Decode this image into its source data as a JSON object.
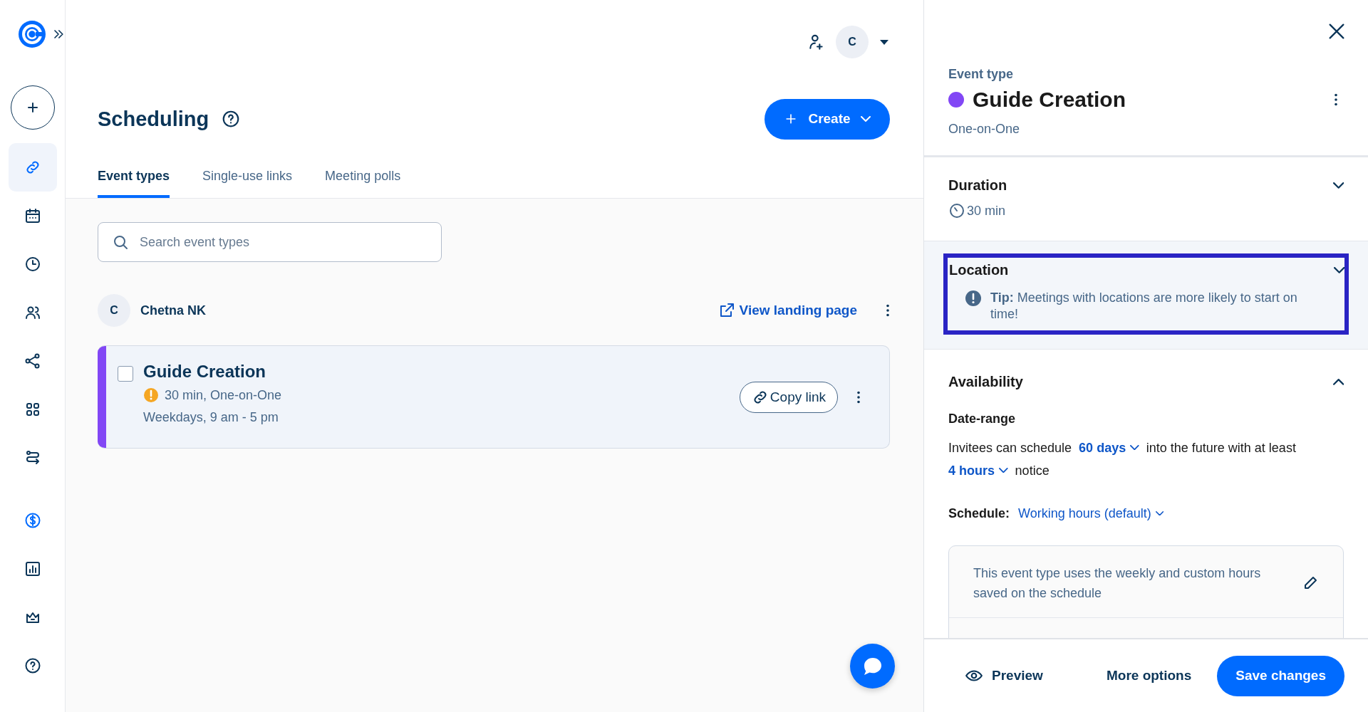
{
  "sidebar": {
    "items": [
      {
        "kind": "create",
        "selected": false
      },
      {
        "kind": "link",
        "selected": true
      },
      {
        "kind": "calendar",
        "selected": false
      },
      {
        "kind": "clock",
        "selected": false
      },
      {
        "kind": "people",
        "selected": false
      },
      {
        "kind": "share",
        "selected": false
      },
      {
        "kind": "grid",
        "selected": false
      },
      {
        "kind": "routing",
        "selected": false
      },
      {
        "kind": "dollar",
        "selected": false
      },
      {
        "kind": "chart",
        "selected": false
      },
      {
        "kind": "crown",
        "selected": false
      },
      {
        "kind": "help",
        "selected": false
      }
    ]
  },
  "header": {
    "avatar": "C"
  },
  "page": {
    "title": "Scheduling",
    "create_button": "Create",
    "tabs": [
      {
        "label": "Event types",
        "selected": true
      },
      {
        "label": "Single-use links",
        "selected": false
      },
      {
        "label": "Meeting polls",
        "selected": false
      }
    ],
    "search": {
      "placeholder": "Search event types"
    },
    "owner": {
      "avatar": "C",
      "name": "Chetna NK",
      "landing_link": "View landing page"
    },
    "event_cards": [
      {
        "title": "Guide Creation",
        "color": "#8247f5",
        "checked": false,
        "warning": true,
        "details": "30 min, One-on-One",
        "schedule": "Weekdays, 9 am - 5 pm",
        "copy_button": "Copy link"
      }
    ]
  },
  "panel": {
    "label": "Event type",
    "title": "Guide Creation",
    "color": "#8247f5",
    "subtitle": "One-on-One",
    "sections": [
      {
        "kind": "duration",
        "title": "Duration",
        "expanded": false,
        "highlighted": false,
        "value": "30 min"
      },
      {
        "kind": "location",
        "title": "Location",
        "expanded": false,
        "highlighted": true,
        "tip": "**Tip:** Meetings with locations are more likely to start on time!"
      },
      {
        "kind": "availability",
        "title": "Availability",
        "expanded": true,
        "highlighted": false,
        "subheading": "Date-range",
        "sentence": [
          {
            "kind": "text",
            "text": "Invitees can schedule"
          },
          {
            "kind": "dropdown",
            "text": "60 days"
          },
          {
            "kind": "text",
            "text": "into the future with at least"
          },
          {
            "kind": "dropdown",
            "text": "4 hours"
          },
          {
            "kind": "text",
            "text": "notice"
          }
        ],
        "schedule_label": "Schedule:",
        "schedule_value": "Working hours (default)",
        "note": "This event type uses the weekly and custom hours saved on the schedule"
      }
    ],
    "footer": {
      "preview": "Preview",
      "more": "More options",
      "save": "Save changes"
    }
  }
}
